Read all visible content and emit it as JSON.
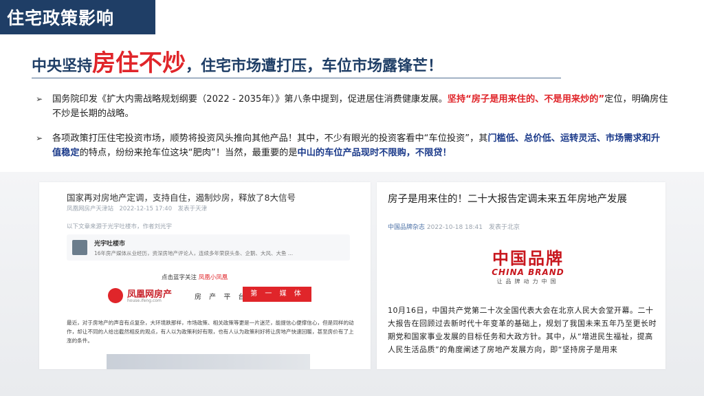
{
  "slide": {
    "title": "住宅政策影响",
    "headline": {
      "pre": "中央坚持",
      "emphasis": "房住不炒",
      "post": "，住宅市场遭打压，车位市场露锋芒！"
    },
    "bullets": [
      {
        "text1": "国务院印发《扩大内需战略规划纲要（2022 - 2035年）》第八条中提到，促进居住消费健康发展。",
        "red": "坚持“房子是用来住的、不是用来炒的”",
        "text2": "定位，明确房住不炒是长期的战略。"
      },
      {
        "text1": "各项政策打压住宅投资市场，顺势将投资风头推向其他产品！其中，不少有眼光的投资客看中“车位投资”，其",
        "blue1": "门槛低、总价低、运转灵活、市场需求和升值稳定",
        "text2": "的特点，纷纷来抢车位这块“肥肉”！当然，最重要的是",
        "blue2": "中山的车位产品现时不限购，不限贷！"
      }
    ]
  },
  "article_left": {
    "title": "国家再对房地产定调，支持自住，遏制炒房，释放了8大信号",
    "meta": "凤凰网房产天津站　2022-12-15 17:40　发表于天津",
    "source_note": "以下文章来源于光宇吐楼市，作者刘光宇",
    "card_name": "光宇吐楼市",
    "card_desc": "16年房产媒体从业经历，资深房地产评论人，连续多年荣获头条、企鹅、大风、大鱼 ...",
    "follow_text": "点击蓝字关注",
    "follow_brand": "凤凰小凤凰",
    "logo_text": "凤凰网房产",
    "logo_sub": "house.ifeng.com",
    "slogan_a": "房 产 平 台",
    "slogan_b": "第 一 媒 体",
    "body": "最近，对于房地产的声音有点复杂，大环境跌那样，市场政策、相关政策等更是一片迷茫，能提信心便撑信心，但是同样的动作，却让不同的人给出截然相反的观点，有人以为政策利好有限，也有人认为政策利好将让房地产快速回暖，甚至房价有了上涨的条件。"
  },
  "article_right": {
    "title": "房子是用来住的！二十大报告定调未来五年房地产发展",
    "meta_source": "中国品牌杂志",
    "meta_rest": "2022-10-18 18:41　发表于北京",
    "brand_cn": "中国品牌",
    "brand_en": "CHINA BRAND",
    "brand_slogan": "让品牌动力中国",
    "body": "10月16日，中国共产党第二十次全国代表大会在北京人民大会堂开幕。二十大报告在回顾过去新时代十年变革的基础上，规划了我国未来五年乃至更长时期党和国家事业发展的目标任务和大政方针。其中，从“增进民生福祉，提高人民生活品质”的角度阐述了房地产发展方向，即“坚持房子是用来"
  }
}
